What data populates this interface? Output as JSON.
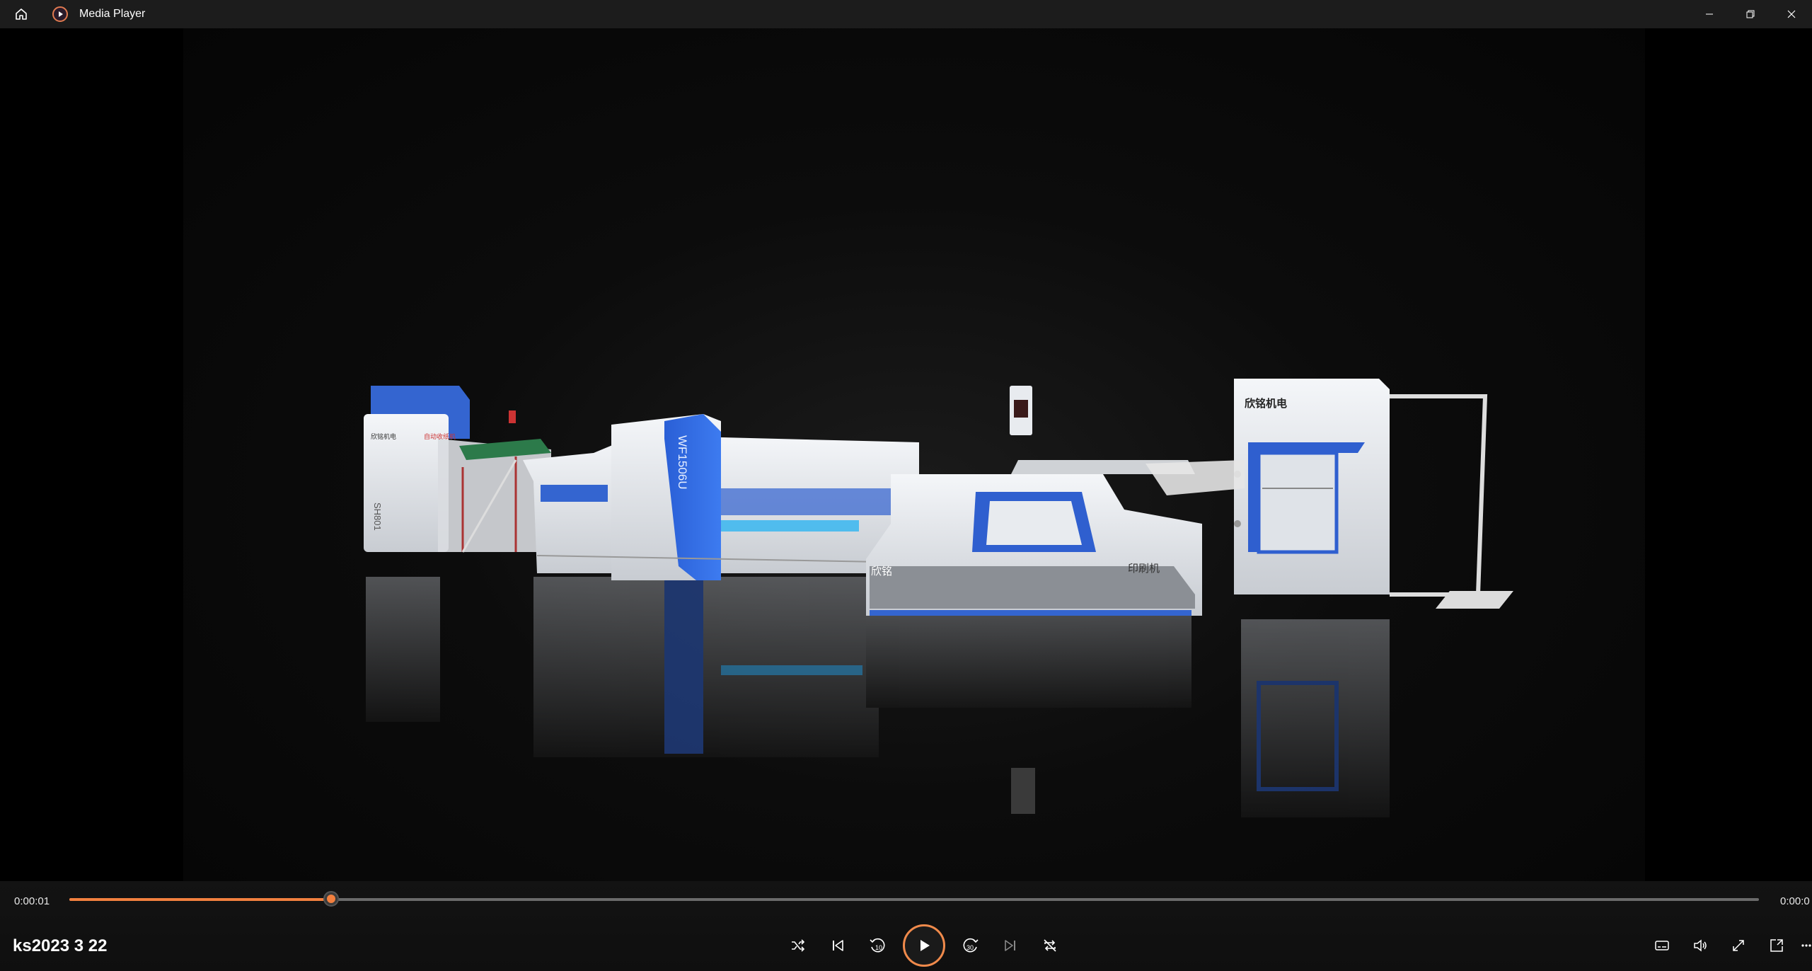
{
  "window": {
    "app_title": "Media Player",
    "icons": {
      "home": "home-icon",
      "app": "media-player-icon",
      "minimize": "minimize-icon",
      "restore": "restore-icon",
      "close": "close-icon"
    }
  },
  "video": {
    "label_unit1": "SH801",
    "label_unit3": "WF1506U",
    "label_printer_brand": "欣铭",
    "label_printer": "印刷机",
    "label_stacker": "欣铭机电"
  },
  "player": {
    "current_time": "0:00:01",
    "end_time": "0:00:0",
    "progress_fraction": 0.155,
    "file_title": "ks2023 3 22",
    "accent": "#f2803f"
  }
}
